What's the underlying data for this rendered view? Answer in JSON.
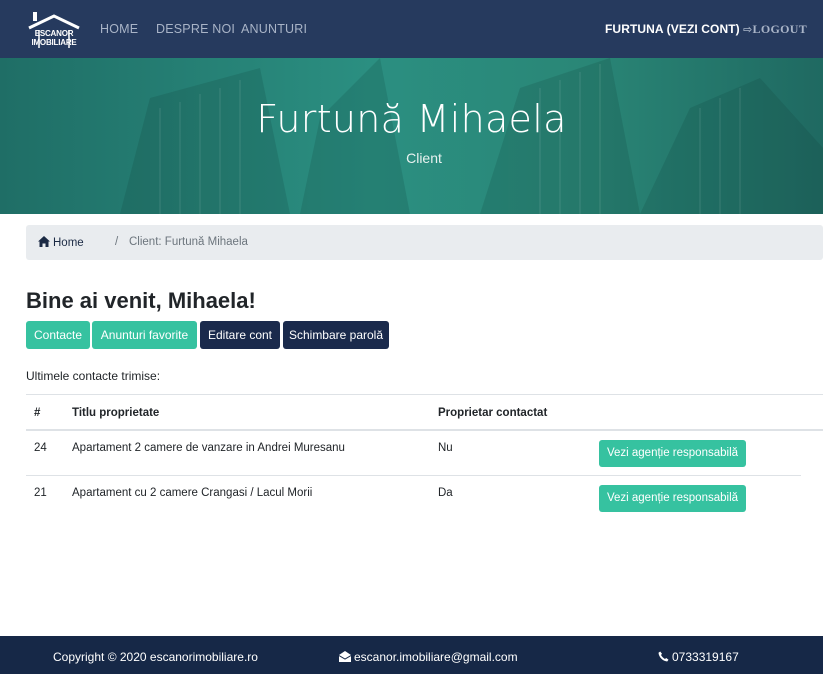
{
  "nav": {
    "logo_line1": "ESCANOR",
    "logo_line2": "IMOBILIARE",
    "links": [
      "HOME",
      "DESPRE NOI",
      "ANUNTURI"
    ],
    "account": "FURTUNA (VEZI CONT)",
    "logout": "LOGOUT"
  },
  "hero": {
    "name": "Furtună Mihaela",
    "role": "Client"
  },
  "breadcrumb": {
    "home": "Home",
    "separator": "/",
    "current": "Client: Furtună Mihaela"
  },
  "main": {
    "welcome": "Bine ai venit, Mihaela!",
    "buttons": [
      "Contacte",
      "Anunturi favorite",
      "Editare cont",
      "Schimbare parolă"
    ],
    "last_contacts_label": "Ultimele contacte trimise:"
  },
  "table": {
    "headers": [
      "#",
      "Titlu proprietate",
      "Proprietar contactat"
    ],
    "rows": [
      {
        "id": "24",
        "title": "Apartament 2 camere de vanzare in Andrei Muresanu",
        "contacted": "Nu",
        "action": "Vezi agenție responsabilă"
      },
      {
        "id": "21",
        "title": "Apartament cu 2 camere Crangasi / Lacul Morii",
        "contacted": "Da",
        "action": "Vezi agenție responsabilă"
      }
    ]
  },
  "footer": {
    "copyright": "Copyright © 2020 escanorimobiliare.ro",
    "email": "escanor.imobiliare@gmail.com",
    "phone": "0733319167"
  },
  "colors": {
    "navbar": "#263a5e",
    "accent_teal": "#36c2a0",
    "navy_button": "#1a2a4c",
    "footer": "#162847"
  }
}
